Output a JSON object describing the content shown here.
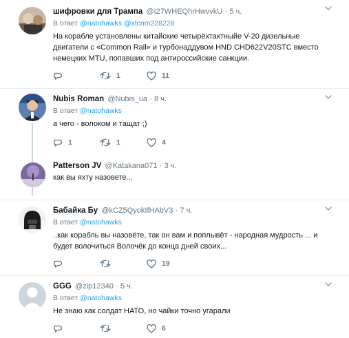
{
  "tweets": [
    {
      "name": "шифровки для Трампа",
      "handle": "@I27WHEQhrHwvvkU",
      "dot": "·",
      "time": "5 ч.",
      "reply_prefix": "В ответ",
      "reply_users": [
        "@natohawks",
        "@xtcnm228228"
      ],
      "text": "На корабле установлены китайские четырёхтактныйе V-20 дизельные двигатели с «Common Rail» и турбонаддувом HND CHD622V20STC вместо немецких MTU, попавших под антироссийские санкции.",
      "replies": "",
      "retweets": "1",
      "likes": "11"
    },
    {
      "name": "Nubis Roman",
      "handle": "@Nubis_ua",
      "dot": "·",
      "time": "8 ч.",
      "reply_prefix": "В ответ",
      "reply_users": [
        "@natohawks"
      ],
      "text": "а чего - волоком и тащат ;)",
      "replies": "1",
      "retweets": "1",
      "likes": "4"
    },
    {
      "name": "Patterson JV",
      "handle": "@Katakana071",
      "dot": "·",
      "time": "3 ч.",
      "text": "как вы яхту назовете...",
      "replies": "",
      "retweets": "",
      "likes": ""
    },
    {
      "name": "Бабайка Бу",
      "handle": "@kCZ5QyokIfHAbV3",
      "dot": "·",
      "time": "7 ч.",
      "reply_prefix": "В ответ",
      "reply_users": [
        "@natohawks"
      ],
      "text": "..как корабль вы назовёте, так он вам и поплывёт - народная мудрость ...  и будет волочиться Волочёк до конца дней своих...",
      "replies": "",
      "retweets": "",
      "likes": "19"
    },
    {
      "name": "GGG",
      "handle": "@zip12340",
      "dot": "·",
      "time": "5 ч.",
      "reply_prefix": "В ответ",
      "reply_users": [
        "@natohawks"
      ],
      "text": "Не знаю как солдат НАТО, но чайки точно угарали",
      "replies": "",
      "retweets": "",
      "likes": "6"
    }
  ],
  "icons": {
    "reply": "reply-icon",
    "retweet": "retweet-icon",
    "like": "heart-icon",
    "more": "chevron-down-icon"
  },
  "colors": {
    "link": "#1da1f2",
    "muted": "#657786",
    "border": "#e6ecf0",
    "thread": "#ccd6dd"
  }
}
